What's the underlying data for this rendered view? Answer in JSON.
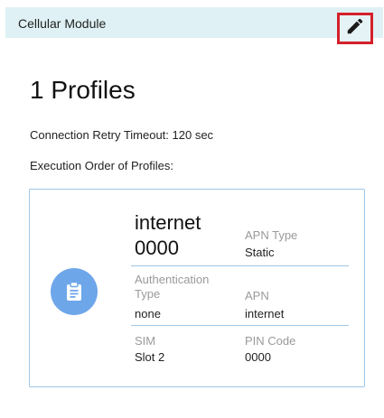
{
  "header": {
    "title": "Cellular Module",
    "edit_icon": "pencil-icon"
  },
  "main": {
    "profiles_title": "1 Profiles",
    "retry_timeout": "Connection Retry Timeout: 120 sec",
    "execution_order_label": "Execution Order of Profiles:"
  },
  "profile_card": {
    "icon": "clipboard-icon",
    "name_line1": "internet",
    "name_line2": "0000",
    "apn_type_label": "APN Type",
    "apn_type_value": "Static",
    "auth_type_label_line1": "Authentication",
    "auth_type_label_line2": "Type",
    "auth_type_value": "none",
    "apn_label": "APN",
    "apn_value": "internet",
    "sim_label": "SIM",
    "sim_value": "Slot 2",
    "pin_label": "PIN Code",
    "pin_value": "0000"
  },
  "colors": {
    "header_bg": "#dff1f4",
    "highlight_border": "#d4202a",
    "icon_bg": "#6ea6ea",
    "card_border": "#9fc7e8"
  }
}
